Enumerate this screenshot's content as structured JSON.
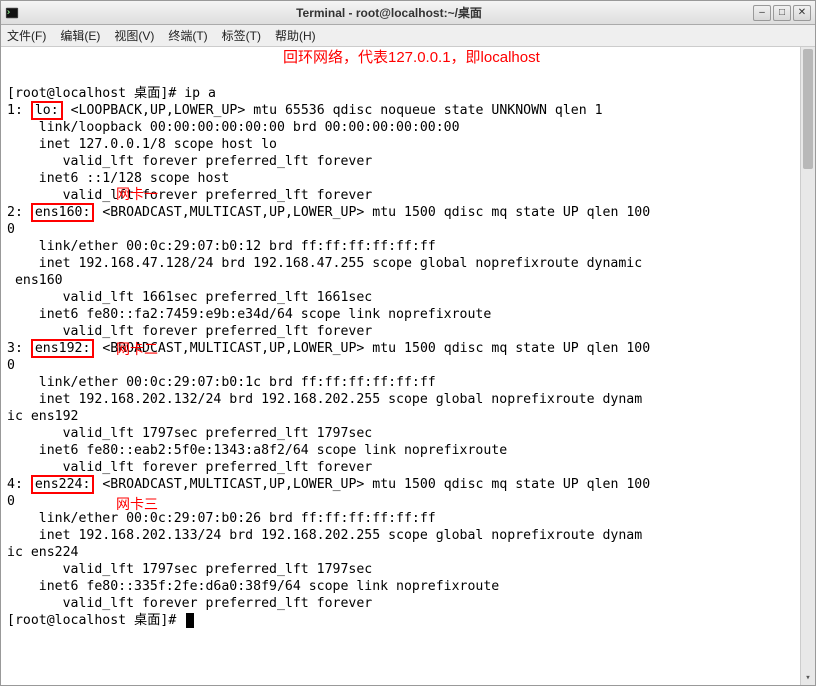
{
  "window": {
    "title": "Terminal - root@localhost:~/桌面"
  },
  "menu": {
    "file": "文件(F)",
    "edit": "编辑(E)",
    "view": "视图(V)",
    "terminal": "终端(T)",
    "tabs": "标签(T)",
    "help": "帮助(H)"
  },
  "prompt": {
    "line1_pre": "[root@localhost 桌面]# ",
    "cmd": "ip a",
    "line_last": "[root@localhost 桌面]# "
  },
  "annotations": {
    "loopback": "回环网络，代表127.0.0.1，即localhost",
    "nic1": "网卡一",
    "nic2": "网卡二",
    "nic3": "网卡三"
  },
  "iface": {
    "lo": {
      "label": "lo:",
      "rest": " <LOOPBACK,UP,LOWER_UP> mtu 65536 qdisc noqueue state UNKNOWN qlen 1",
      "link": "    link/loopback 00:00:00:00:00:00 brd 00:00:00:00:00:00",
      "inet": "    inet 127.0.0.1/8 scope host lo",
      "valid": "       valid_lft forever preferred_lft forever",
      "inet6": "    inet6 ::1/128 scope host ",
      "valid6": "       valid_lft forever preferred_lft forever"
    },
    "ens160": {
      "label": "ens160:",
      "rest1": " <BROADCAST,MULTICAST,UP,LOWER_UP> mtu 1500 qdisc mq state UP qlen 100",
      "rest2": "0",
      "link": "    link/ether 00:0c:29:07:b0:12 brd ff:ff:ff:ff:ff:ff",
      "inet1": "    inet 192.168.47.128/24 brd 192.168.47.255 scope global noprefixroute dynamic",
      "inet2": " ens160",
      "valid": "       valid_lft 1661sec preferred_lft 1661sec",
      "inet6": "    inet6 fe80::fa2:7459:e9b:e34d/64 scope link noprefixroute ",
      "valid6": "       valid_lft forever preferred_lft forever"
    },
    "ens192": {
      "label": "ens192:",
      "rest1": "<BROADCAST,MULTICAST,UP,LOWER_UP> mtu 1500 qdisc mq state UP qlen 100",
      "rest2": "0",
      "link": "    link/ether 00:0c:29:07:b0:1c brd ff:ff:ff:ff:ff:ff",
      "inet1": "    inet 192.168.202.132/24 brd 192.168.202.255 scope global noprefixroute dynam",
      "inet2": "ic ens192",
      "valid": "       valid_lft 1797sec preferred_lft 1797sec",
      "inet6": "    inet6 fe80::eab2:5f0e:1343:a8f2/64 scope link noprefixroute ",
      "valid6": "       valid_lft forever preferred_lft forever"
    },
    "ens224": {
      "label": "ens224:",
      "rest1": " <BROADCAST,MULTICAST,UP,LOWER_UP> mtu 1500 qdisc mq state UP qlen 100",
      "rest2": "0",
      "link": "    link/ether 00:0c:29:07:b0:26 brd ff:ff:ff:ff:ff:ff",
      "inet1": "    inet 192.168.202.133/24 brd 192.168.202.255 scope global noprefixroute dynam",
      "inet2": "ic ens224",
      "valid": "       valid_lft 1797sec preferred_lft 1797sec",
      "inet6": "    inet6 fe80::335f:2fe:d6a0:38f9/64 scope link noprefixroute ",
      "valid6": "       valid_lft forever preferred_lft forever"
    }
  }
}
